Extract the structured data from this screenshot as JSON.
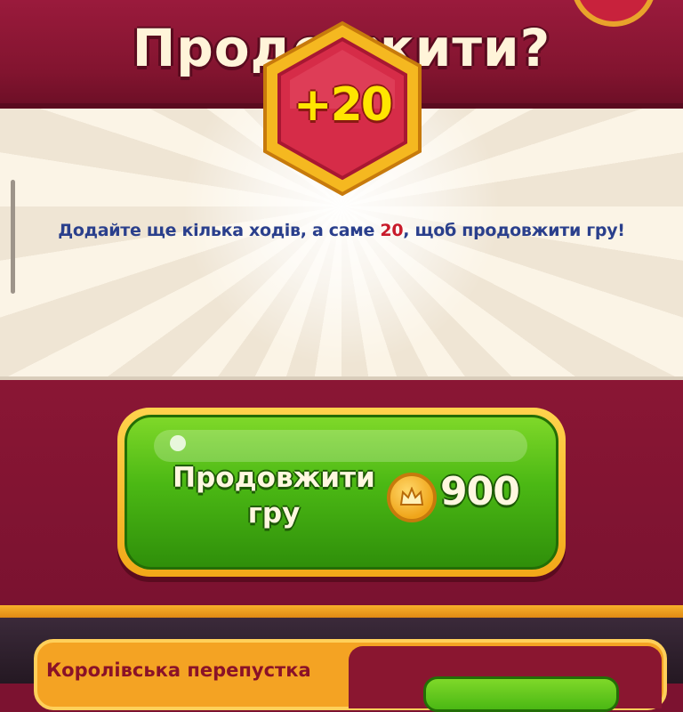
{
  "header": {
    "title": "Продовжити?"
  },
  "reward": {
    "badge_text": "+20",
    "description_before": "Додайте ще кілька ходів, а саме ",
    "description_number": "20",
    "description_after": ", щоб продовжити гру!"
  },
  "continue_button": {
    "label": "Продовжити гру",
    "coin_icon": "crown-coin-icon",
    "price": "900"
  },
  "royal_pass": {
    "title": "Королівська перепустка"
  },
  "colors": {
    "background": "#7c1230",
    "title_text": "#fff4d9",
    "description_text": "#2a3f8c",
    "highlight_number": "#c81a2a",
    "button_green": "#4bb814",
    "button_border": "#f2a818",
    "badge_yellow": "#ffe600"
  }
}
